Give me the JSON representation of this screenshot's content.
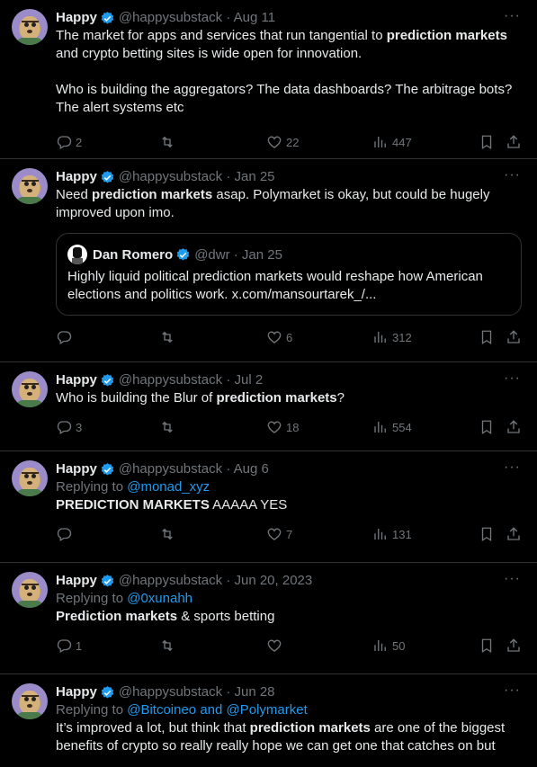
{
  "colors": {
    "background": "#000000",
    "text": "#e7e9ea",
    "muted": "#71767b",
    "accent": "#1d9bf0",
    "border": "#2f3336"
  },
  "icons": [
    "verified-badge-icon",
    "more-icon",
    "reply-icon",
    "retweet-icon",
    "like-icon",
    "views-icon",
    "bookmark-icon",
    "share-icon"
  ],
  "tweets": [
    {
      "name": "Happy",
      "handle": "@happysubstack",
      "date": "· Aug 11",
      "text_parts": [
        "The market for apps and services that run tangential to ",
        "prediction markets",
        " and crypto betting sites is wide open for innovation.\n\nWho is building the aggregators? The data dashboards? The arbitrage bots? The alert systems etc"
      ],
      "replies": "2",
      "retweets": "",
      "likes": "22",
      "views": "447"
    },
    {
      "name": "Happy",
      "handle": "@happysubstack",
      "date": "· Jan 25",
      "text_parts": [
        "Need ",
        "prediction markets",
        " asap. Polymarket is okay, but could be hugely improved upon imo."
      ],
      "quote": {
        "name": "Dan Romero",
        "handle": "@dwr",
        "date": "· Jan 25",
        "text": "Highly liquid political prediction markets would reshape how American elections and politics work. x.com/mansourtarek_/..."
      },
      "replies": "",
      "retweets": "",
      "likes": "6",
      "views": "312"
    },
    {
      "name": "Happy",
      "handle": "@happysubstack",
      "date": "· Jul 2",
      "text_parts": [
        "Who is building the Blur of ",
        "prediction markets",
        "?"
      ],
      "replies": "3",
      "retweets": "",
      "likes": "18",
      "views": "554"
    },
    {
      "name": "Happy",
      "handle": "@happysubstack",
      "date": "· Aug 6",
      "replying_label": "Replying to ",
      "replying_to": "@monad_xyz",
      "text_parts": [
        "",
        "PREDICTION MARKETS",
        " AAAAA YES"
      ],
      "replies": "",
      "retweets": "",
      "likes": "7",
      "views": "131"
    },
    {
      "name": "Happy",
      "handle": "@happysubstack",
      "date": "· Jun 20, 2023",
      "replying_label": "Replying to ",
      "replying_to": "@0xunahh",
      "text_parts": [
        "",
        "Prediction markets",
        " & sports betting"
      ],
      "replies": "1",
      "retweets": "",
      "likes": "",
      "views": "50"
    },
    {
      "name": "Happy",
      "handle": "@happysubstack",
      "date": "· Jun 28",
      "replying_label": "Replying to ",
      "replying_to": "@Bitcoineo and @Polymarket",
      "text_parts": [
        "It’s improved a lot, but think that ",
        "prediction markets",
        " are one of the biggest benefits of crypto so really really hope we can get one that catches on but"
      ]
    }
  ]
}
